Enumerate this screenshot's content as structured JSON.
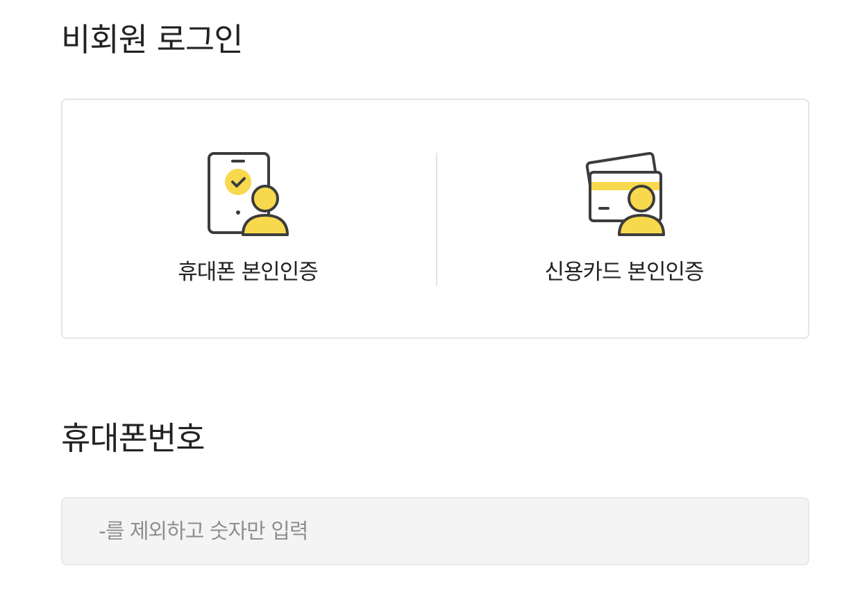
{
  "page_title": "비회원 로그인",
  "auth_methods": [
    {
      "label": "휴대폰 본인인증",
      "icon": "phone-verification-icon"
    },
    {
      "label": "신용카드 본인인증",
      "icon": "credit-card-verification-icon"
    }
  ],
  "phone_section": {
    "title": "휴대폰번호",
    "placeholder": "-를 제외하고 숫자만 입력",
    "value": ""
  },
  "colors": {
    "accent_yellow": "#f8d94e",
    "icon_stroke": "#3c3c3c",
    "card_border": "#e6e6e6",
    "input_background": "#f4f4f4"
  }
}
